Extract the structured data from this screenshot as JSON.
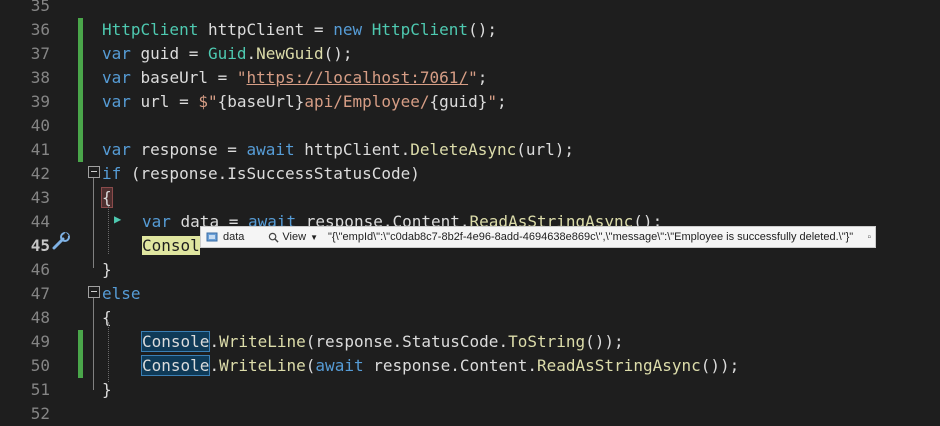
{
  "editor": {
    "lines": [
      {
        "num": "35",
        "tokens": []
      },
      {
        "num": "36",
        "tokens": [
          [
            "type",
            "HttpClient"
          ],
          [
            "plain",
            " httpClient = "
          ],
          [
            "kw",
            "new"
          ],
          [
            "plain",
            " "
          ],
          [
            "type",
            "HttpClient"
          ],
          [
            "plain",
            "();"
          ]
        ]
      },
      {
        "num": "37",
        "tokens": [
          [
            "kw",
            "var"
          ],
          [
            "plain",
            " guid = "
          ],
          [
            "type",
            "Guid"
          ],
          [
            "plain",
            "."
          ],
          [
            "method",
            "NewGuid"
          ],
          [
            "plain",
            "();"
          ]
        ]
      },
      {
        "num": "38",
        "tokens": [
          [
            "kw",
            "var"
          ],
          [
            "plain",
            " baseUrl = "
          ],
          [
            "str",
            "\""
          ],
          [
            "url",
            "https://localhost:7061/"
          ],
          [
            "str",
            "\""
          ],
          [
            "plain",
            ";"
          ]
        ]
      },
      {
        "num": "39",
        "tokens": [
          [
            "kw",
            "var"
          ],
          [
            "plain",
            " url = "
          ],
          [
            "str",
            "$\""
          ],
          [
            "interp",
            "{baseUrl}"
          ],
          [
            "str",
            "api/Employee/"
          ],
          [
            "interp",
            "{guid}"
          ],
          [
            "str",
            "\""
          ],
          [
            "plain",
            ";"
          ]
        ]
      },
      {
        "num": "40",
        "tokens": []
      },
      {
        "num": "41",
        "tokens": [
          [
            "kw",
            "var"
          ],
          [
            "plain",
            " response = "
          ],
          [
            "kw",
            "await"
          ],
          [
            "plain",
            " httpClient."
          ],
          [
            "method",
            "DeleteAsync"
          ],
          [
            "plain",
            "(url);"
          ]
        ]
      },
      {
        "num": "42",
        "tokens": [
          [
            "kw",
            "if"
          ],
          [
            "plain",
            " (response.IsSuccessStatusCode)"
          ]
        ]
      },
      {
        "num": "43",
        "tokens": [
          [
            "brace",
            "{"
          ]
        ]
      },
      {
        "num": "44",
        "tokens": [
          [
            "kw",
            "var"
          ],
          [
            "plain",
            " data = "
          ],
          [
            "kw",
            "await"
          ],
          [
            "plain",
            " response.Content."
          ],
          [
            "method",
            "ReadAsStringAsync"
          ],
          [
            "plain",
            "();"
          ]
        ]
      },
      {
        "num": "45",
        "tokens": [
          [
            "breakline",
            "Consol"
          ]
        ]
      },
      {
        "num": "46",
        "tokens": [
          [
            "plain",
            "}"
          ]
        ]
      },
      {
        "num": "47",
        "tokens": [
          [
            "kw",
            "else"
          ]
        ]
      },
      {
        "num": "48",
        "tokens": [
          [
            "plain",
            "{"
          ]
        ]
      },
      {
        "num": "49",
        "tokens": [
          [
            "cls",
            "Console"
          ],
          [
            "plain",
            "."
          ],
          [
            "method",
            "WriteLine"
          ],
          [
            "plain",
            "(response.StatusCode."
          ],
          [
            "method",
            "ToString"
          ],
          [
            "plain",
            "());"
          ]
        ]
      },
      {
        "num": "50",
        "tokens": [
          [
            "cls",
            "Console"
          ],
          [
            "plain",
            "."
          ],
          [
            "method",
            "WriteLine"
          ],
          [
            "plain",
            "("
          ],
          [
            "kw",
            "await"
          ],
          [
            "plain",
            " response.Content."
          ],
          [
            "method",
            "ReadAsStringAsync"
          ],
          [
            "plain",
            "());"
          ]
        ]
      },
      {
        "num": "51",
        "tokens": [
          [
            "plain",
            "}"
          ]
        ]
      },
      {
        "num": "52",
        "tokens": []
      }
    ],
    "active_line": "45",
    "changed_lines": [
      "36",
      "37",
      "38",
      "39",
      "40",
      "41",
      "49",
      "50"
    ]
  },
  "datatip": {
    "name": "data",
    "view_label": "View",
    "value": "\"{\\\"empId\\\":\\\"c0dab8c7-8b2f-4e96-8add-4694638e869c\\\",\\\"message\\\":\\\"Employee is successfully deleted.\\\"}\""
  },
  "colors": {
    "background": "#1e1e1e",
    "keyword": "#569cd6",
    "type": "#4ec9b0",
    "method": "#dcdcaa",
    "string": "#d69d85",
    "change_bar": "#4aa64a"
  },
  "icons": {
    "debug_marker": "wrench-debug-icon",
    "exec_arrow": "run-to-cursor-icon",
    "datatip_icon": "variable-icon",
    "view_icon": "magnifier-icon",
    "pin_icon": "pin-icon"
  }
}
